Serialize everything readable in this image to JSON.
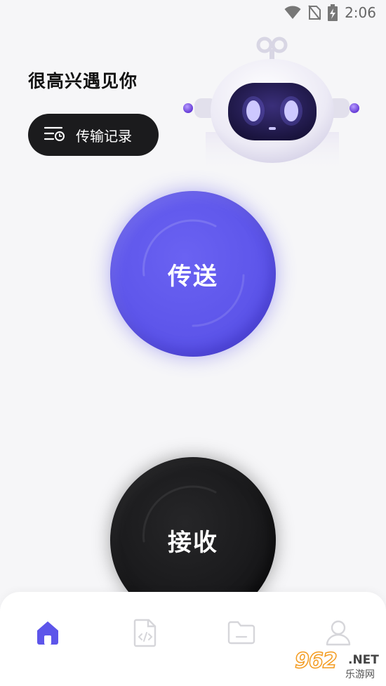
{
  "status_bar": {
    "time": "2:06",
    "icons": [
      "wifi-icon",
      "no-sim-icon",
      "battery-charging-icon"
    ]
  },
  "header": {
    "greeting": "很高兴遇见你",
    "history_button_label": "传输记录",
    "history_icon": "history-list-icon"
  },
  "main": {
    "send_label": "传送",
    "receive_label": "接收",
    "send_color": "#5d55ea",
    "receive_color": "#19191b"
  },
  "bottom_nav": {
    "items": [
      {
        "icon": "home-icon",
        "active": true
      },
      {
        "icon": "code-file-icon",
        "active": false
      },
      {
        "icon": "folder-icon",
        "active": false
      },
      {
        "icon": "user-icon",
        "active": false
      }
    ],
    "active_color": "#5d55ea",
    "inactive_color": "#d6d6da"
  },
  "watermark": {
    "logo": "962",
    "domain": ".NET",
    "subtitle": "乐游网"
  }
}
